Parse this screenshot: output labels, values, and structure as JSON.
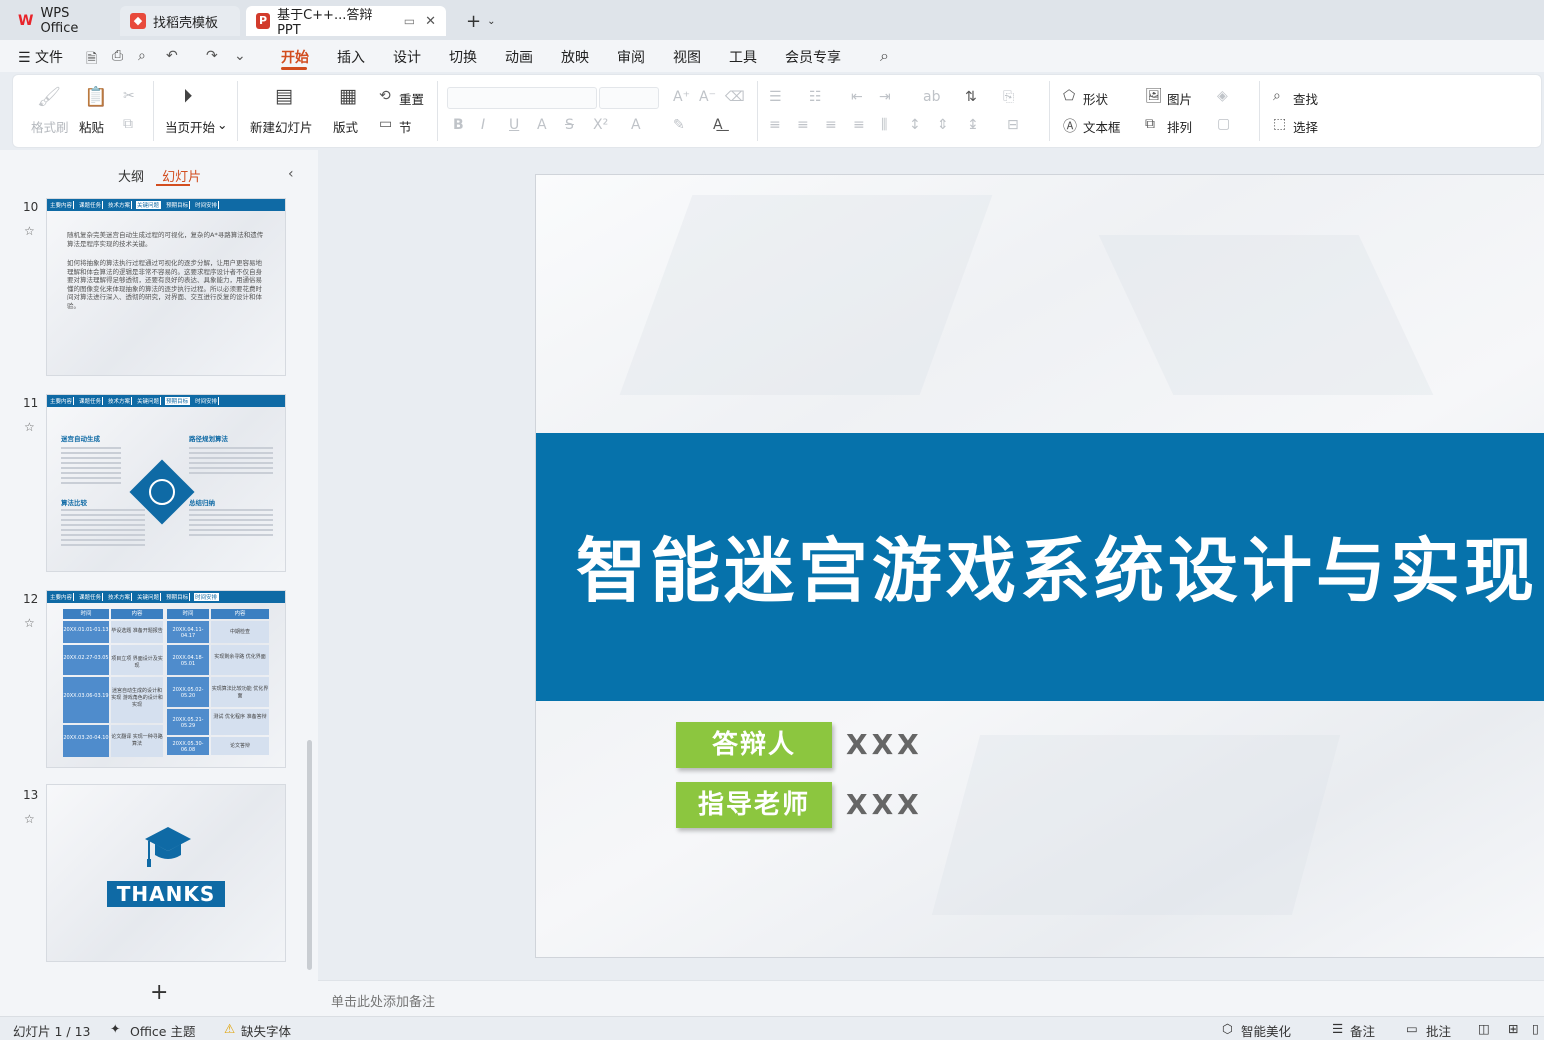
{
  "tabs": {
    "wps": "WPS Office",
    "find_template": "找稻壳模板",
    "document": "基于C++...答辩PPT"
  },
  "menu": {
    "file": "文件",
    "items": [
      "开始",
      "插入",
      "设计",
      "切换",
      "动画",
      "放映",
      "审阅",
      "视图",
      "工具",
      "会员专享"
    ]
  },
  "ribbon": {
    "format_painter": "格式刷",
    "paste": "粘贴",
    "play_from_current": "当页开始",
    "new_slide": "新建幻灯片",
    "layout": "版式",
    "reset": "重置",
    "section": "节",
    "shape": "形状",
    "picture": "图片",
    "find": "查找",
    "textbox": "文本框",
    "arrange": "排列",
    "select": "选择"
  },
  "panel": {
    "outline_tab": "大纲",
    "slides_tab": "幻灯片",
    "slide_numbers": [
      "10",
      "11",
      "12",
      "13"
    ],
    "thumb_nav": [
      "主要内容",
      "课题任务",
      "技术方案",
      "关键问题",
      "预期目标",
      "时间安排"
    ],
    "thumb10": {
      "line1": "随机复杂完美迷宫自动生成过程的可视化，复杂的A*寻路算法和遗传算法是程序实现的技术关键。",
      "line2": "如何将抽象的算法执行过程通过可视化的逐步分解，让用户更容易地理解和体会算法的逻辑是非常不容易的。这要求程序设计者不仅自身要对算法理解得足够透彻，还要有良好的表达、具象能力，用通俗易懂的图像变化来体现抽象的算法的逐步执行过程。所以必须要花费时间对算法进行深入、透彻的研究，对界面、交互进行反复的设计和体验。"
    },
    "thumb11": {
      "t1": "迷宫自动生成",
      "t2": "路径规划算法",
      "t3": "算法比较",
      "t4": "总结归纳"
    },
    "thumb12": {
      "h_time": "时间",
      "h_content": "内容",
      "rows_left": [
        "20XX.01.01-01.13",
        "20XX.02.27-03.05",
        "20XX.03.06-03.19",
        "20XX.03.20-04.10"
      ],
      "content_left": [
        "毕设选题 准备开题报告",
        "项目立项 界面设计及实现",
        "迷宫自动生成的设计和实现 游戏角色的设计和实现",
        "论文翻译 实现一种寻路算法"
      ],
      "rows_right": [
        "20XX.04.11-04.17",
        "20XX.04.18-05.01",
        "20XX.05.02-05.20",
        "20XX.05.21-05.29",
        "20XX.05.30-06.08"
      ],
      "content_right": [
        "中期检查",
        "实现剩余寻路 优化界面",
        "实现算法比较功能 优化界面",
        "测试 优化程序 准备答辩",
        "论文答辩"
      ]
    },
    "thumb13": {
      "thanks": "THANKS"
    }
  },
  "slide": {
    "title": "智能迷宫游戏系统设计与实现",
    "label1": "答辩人",
    "value1": "XXX",
    "label2": "指导老师",
    "value2": "XXX"
  },
  "notes": {
    "placeholder": "单击此处添加备注"
  },
  "status": {
    "slide_count": "幻灯片 1 / 13",
    "theme": "Office 主题",
    "missing_font": "缺失字体",
    "smart_beautify": "智能美化",
    "notes": "备注",
    "comments": "批注"
  },
  "colors": {
    "accent": "#d24d1f",
    "title_band": "#0672ab",
    "label_green": "#8cc63f"
  }
}
